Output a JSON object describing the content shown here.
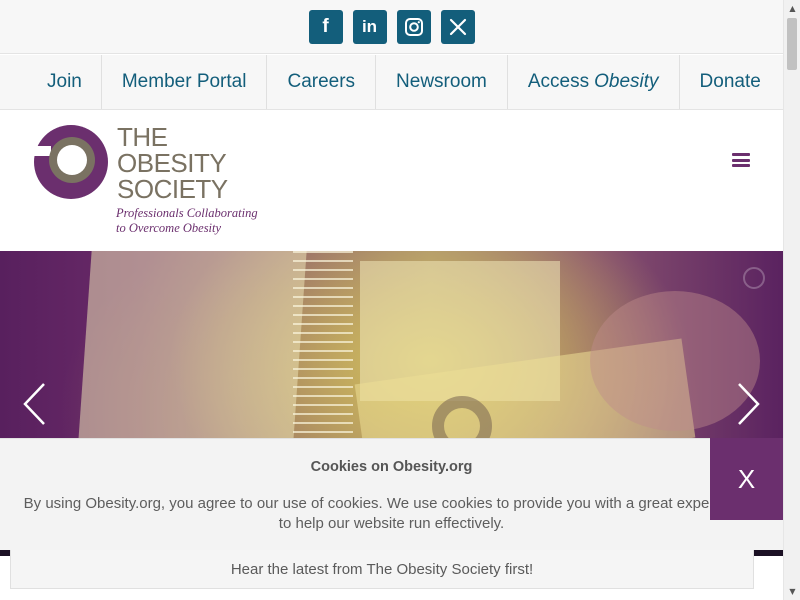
{
  "social": {
    "items": [
      {
        "name": "facebook",
        "icon": "facebook-icon",
        "glyph": "f"
      },
      {
        "name": "linkedin",
        "icon": "linkedin-icon",
        "glyph": "in"
      },
      {
        "name": "instagram",
        "icon": "instagram-icon"
      },
      {
        "name": "x",
        "icon": "x-icon"
      }
    ],
    "color": "#135e7b"
  },
  "nav": {
    "join": "Join",
    "member_portal": "Member Portal",
    "careers": "Careers",
    "newsroom": "Newsroom",
    "access_prefix": "Access",
    "access_italic": "Obesity",
    "donate": "Donate"
  },
  "logo": {
    "line1": "THE",
    "line2": "OBESITY",
    "line3": "SOCIETY",
    "tagline1": "Professionals Collaborating",
    "tagline2": "to Overcome Obesity"
  },
  "header": {
    "menu_icon": "hamburger-menu-icon"
  },
  "slider": {
    "prev_icon": "chevron-left-icon",
    "next_icon": "chevron-right-icon"
  },
  "newsletter": {
    "text": "Hear the latest from The Obesity Society first!"
  },
  "cookie": {
    "title": "Cookies on Obesity.org",
    "line1": "By using Obesity.org, you agree to our use of cookies. We use cookies to provide you with a great experience and",
    "line2": "to help our website run effectively.",
    "close_label": "X"
  },
  "colors": {
    "brand_blue": "#135e7b",
    "brand_purple": "#6b2f6e",
    "logo_gray": "#7a7262"
  }
}
